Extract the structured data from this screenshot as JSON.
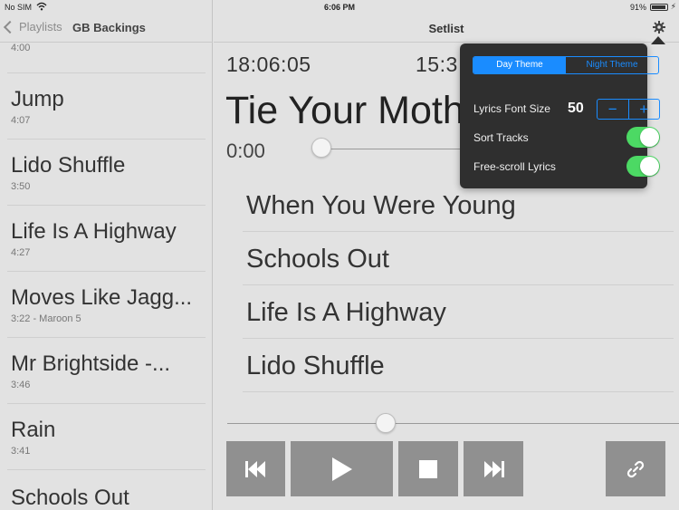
{
  "status_bar": {
    "carrier": "No SIM",
    "time": "6:06 PM",
    "battery": "91%"
  },
  "left_pane": {
    "back_label": "Playlists",
    "title": "GB Backings",
    "tracks": [
      {
        "title": "",
        "meta": "4:00"
      },
      {
        "title": "Jump",
        "meta": "4:07"
      },
      {
        "title": "Lido Shuffle",
        "meta": "3:50"
      },
      {
        "title": "Life Is A Highway",
        "meta": "4:27"
      },
      {
        "title": "Moves Like Jagg...",
        "meta": "3:22 - Maroon 5"
      },
      {
        "title": "Mr Brightside -...",
        "meta": "3:46"
      },
      {
        "title": "Rain",
        "meta": "3:41"
      },
      {
        "title": "Schools Out",
        "meta": ""
      }
    ]
  },
  "main": {
    "title": "Setlist",
    "clock_time": "18:06:05",
    "other_time": "15:3",
    "song_title": "Tie Your Moth",
    "position": "0:00",
    "setlist": [
      "When You Were Young",
      "Schools Out",
      "Life Is A Highway",
      "Lido Shuffle"
    ],
    "progress_fraction": 0.0,
    "volume_fraction": 0.35
  },
  "controls": {
    "prev_icon": "skip-back-icon",
    "play_icon": "play-icon",
    "stop_icon": "stop-icon",
    "next_icon": "skip-forward-icon",
    "link_icon": "link-icon"
  },
  "settings": {
    "day_theme": "Day Theme",
    "night_theme": "Night Theme",
    "lyrics_font_size_label": "Lyrics Font Size",
    "lyrics_font_size": "50",
    "minus": "−",
    "plus": "+",
    "sort_tracks": "Sort Tracks",
    "free_scroll": "Free-scroll Lyrics"
  },
  "colors": {
    "accent": "#1a8cff",
    "toggle_on": "#4cd964",
    "popover_bg": "#2f2f2f",
    "control_bg": "#909090"
  }
}
